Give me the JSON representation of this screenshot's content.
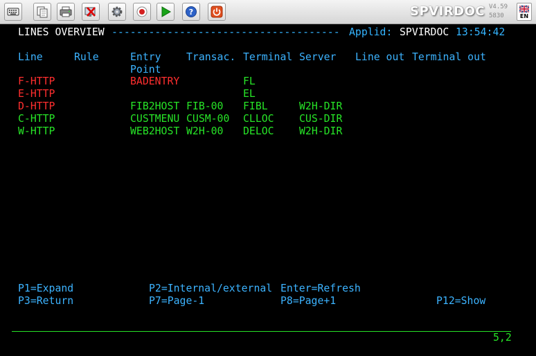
{
  "toolbar": {
    "buttons": [
      {
        "name": "keyboard-icon"
      },
      {
        "name": "copy-icon"
      },
      {
        "name": "print-icon"
      },
      {
        "name": "disconnect-icon"
      },
      {
        "name": "gear-icon"
      },
      {
        "name": "record-icon"
      },
      {
        "name": "play-icon"
      },
      {
        "name": "help-icon"
      },
      {
        "name": "power-icon"
      }
    ],
    "brand": "SPVIRDOC",
    "version": "V4.59",
    "build": "5830",
    "lang": "EN"
  },
  "screen": {
    "title": "LINES OVERVIEW",
    "dashes": "-------------------------------------",
    "applid_label": "Applid:",
    "applid_value": "SPVIRDOC",
    "time": "13:54:42",
    "columns": {
      "line": "Line",
      "rule": "Rule",
      "entry": "Entry",
      "point": "Point",
      "transac": "Transac.",
      "terminal": "Terminal",
      "server": "Server",
      "line_out": "Line out",
      "terminal_out": "Terminal out"
    },
    "rows": [
      {
        "line": "F-HTTP",
        "rule": "",
        "entry": "BADENTRY",
        "transac": "",
        "terminal": "FL",
        "server": "",
        "color": "#ff2e2e"
      },
      {
        "line": "E-HTTP",
        "rule": "",
        "entry": "",
        "transac": "",
        "terminal": "EL",
        "server": "",
        "color": "#ff2e2e"
      },
      {
        "line": "D-HTTP",
        "rule": "",
        "entry": "FIB2HOST",
        "transac": "FIB-00",
        "terminal": "FIBL",
        "server": "W2H-DIR",
        "color": "#ff2e2e"
      },
      {
        "line": "C-HTTP",
        "rule": "",
        "entry": "CUSTMENU",
        "transac": "CUSM-00",
        "terminal": "CLLOC",
        "server": "CUS-DIR",
        "color": "#27e427"
      },
      {
        "line": "W-HTTP",
        "rule": "",
        "entry": "WEB2HOST",
        "transac": "W2H-00",
        "terminal": "DELOC",
        "server": "W2H-DIR",
        "color": "#27e427"
      }
    ],
    "pfkeys": {
      "p1": "P1=Expand",
      "p2": "P2=Internal/external",
      "enter": "Enter=Refresh",
      "p3": "P3=Return",
      "p7": "P7=Page-1",
      "p8": "P8=Page+1",
      "p12": "P12=Show"
    },
    "cursor": "5,2"
  }
}
